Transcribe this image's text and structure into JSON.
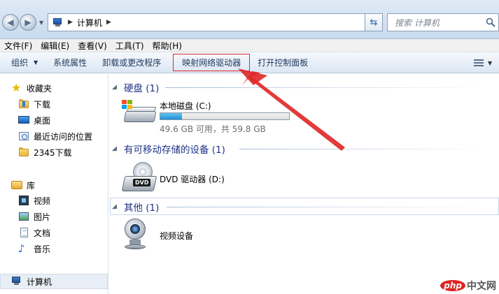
{
  "address_bar": {
    "crumbs": [
      "计算机"
    ],
    "search_placeholder": "搜索 计算机"
  },
  "menu": [
    "文件(F)",
    "编辑(E)",
    "查看(V)",
    "工具(T)",
    "帮助(H)"
  ],
  "commands": {
    "organize": "组织",
    "system_properties": "系统属性",
    "uninstall": "卸载或更改程序",
    "map_drive": "映射网络驱动器",
    "control_panel": "打开控制面板"
  },
  "sidebar": {
    "favorites": "收藏夹",
    "favorites_items": [
      "下载",
      "桌面",
      "最近访问的位置",
      "2345下载"
    ],
    "libraries": "库",
    "library_items": [
      "视频",
      "图片",
      "文档",
      "音乐"
    ],
    "computer": "计算机"
  },
  "groups": [
    {
      "title": "硬盘 (1)"
    },
    {
      "title": "有可移动存储的设备 (1)"
    },
    {
      "title": "其他 (1)"
    }
  ],
  "drives": {
    "local_disk": {
      "name": "本地磁盘 (C:)",
      "free_text": "49.6 GB 可用，共 59.8 GB",
      "used_fraction": 0.17
    },
    "dvd": {
      "name": "DVD 驱动器 (D:)",
      "badge": "DVD"
    },
    "camera": {
      "name": "视频设备"
    }
  },
  "annotation": {
    "color": "#e02a2a"
  },
  "watermark": {
    "logo": "php",
    "text": "中文网"
  }
}
